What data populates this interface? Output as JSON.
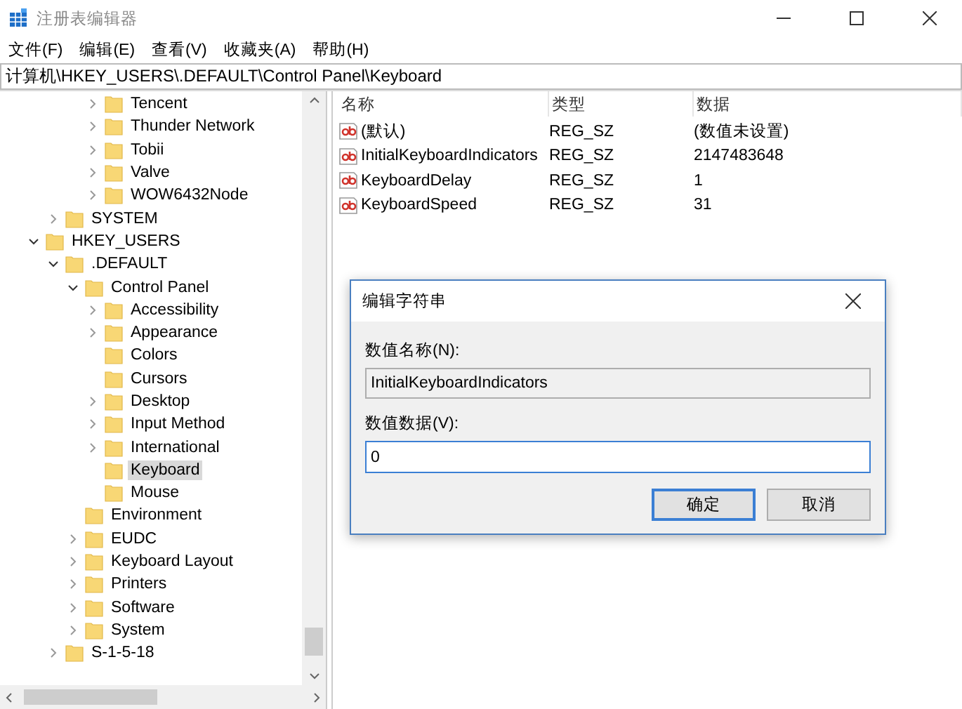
{
  "window": {
    "title": "注册表编辑器"
  },
  "menu": [
    "文件(F)",
    "编辑(E)",
    "查看(V)",
    "收藏夹(A)",
    "帮助(H)"
  ],
  "address": "计算机\\HKEY_USERS\\.DEFAULT\\Control Panel\\Keyboard",
  "tree": [
    {
      "children": [
        {
          "children": [
            {
              "children": [
                {
                  "label": "Tencent",
                  "has_children": true,
                  "expanded": false,
                  "selected": false
                },
                {
                  "label": "Thunder Network",
                  "has_children": true,
                  "expanded": false,
                  "selected": false
                },
                {
                  "label": "Tobii",
                  "has_children": true,
                  "expanded": false,
                  "selected": false
                },
                {
                  "label": "Valve",
                  "has_children": true,
                  "expanded": false,
                  "selected": false
                },
                {
                  "label": "WOW6432Node",
                  "has_children": true,
                  "expanded": false,
                  "selected": false
                }
              ]
            }
          ]
        },
        {
          "label": "SYSTEM",
          "has_children": true,
          "expanded": false,
          "selected": false
        }
      ]
    },
    {
      "label": "HKEY_USERS",
      "has_children": true,
      "expanded": true,
      "selected": false,
      "children": [
        {
          "label": ".DEFAULT",
          "has_children": true,
          "expanded": true,
          "selected": false,
          "children": [
            {
              "label": "Control Panel",
              "has_children": true,
              "expanded": true,
              "selected": false,
              "children": [
                {
                  "label": "Accessibility",
                  "has_children": true,
                  "expanded": false,
                  "selected": false
                },
                {
                  "label": "Appearance",
                  "has_children": true,
                  "expanded": false,
                  "selected": false
                },
                {
                  "label": "Colors",
                  "has_children": false,
                  "selected": false
                },
                {
                  "label": "Cursors",
                  "has_children": false,
                  "selected": false
                },
                {
                  "label": "Desktop",
                  "has_children": true,
                  "expanded": false,
                  "selected": false
                },
                {
                  "label": "Input Method",
                  "has_children": true,
                  "expanded": false,
                  "selected": false
                },
                {
                  "label": "International",
                  "has_children": true,
                  "expanded": false,
                  "selected": false
                },
                {
                  "label": "Keyboard",
                  "has_children": false,
                  "selected": true
                },
                {
                  "label": "Mouse",
                  "has_children": false,
                  "selected": false
                }
              ]
            },
            {
              "label": "Environment",
              "has_children": false,
              "selected": false
            },
            {
              "label": "EUDC",
              "has_children": true,
              "expanded": false,
              "selected": false
            },
            {
              "label": "Keyboard Layout",
              "has_children": true,
              "expanded": false,
              "selected": false
            },
            {
              "label": "Printers",
              "has_children": true,
              "expanded": false,
              "selected": false
            },
            {
              "label": "Software",
              "has_children": true,
              "expanded": false,
              "selected": false
            },
            {
              "label": "System",
              "has_children": true,
              "expanded": false,
              "selected": false
            }
          ]
        },
        {
          "label": "S-1-5-18",
          "has_children": true,
          "expanded": false,
          "selected": false
        }
      ]
    }
  ],
  "table": {
    "columns": [
      "名称",
      "类型",
      "数据"
    ],
    "rows": [
      [
        "(默认)",
        "REG_SZ",
        "(数值未设置)"
      ],
      [
        "InitialKeyboardIndicators",
        "REG_SZ",
        "2147483648"
      ],
      [
        "KeyboardDelay",
        "REG_SZ",
        "1"
      ],
      [
        "KeyboardSpeed",
        "REG_SZ",
        "31"
      ]
    ]
  },
  "dialog": {
    "title": "编辑字符串",
    "name_label": "数值名称(N):",
    "name_value": "InitialKeyboardIndicators",
    "data_label": "数值数据(V):",
    "data_value": "0",
    "buttons": [
      {
        "label": "确定",
        "focused": true
      },
      {
        "label": "取消",
        "focused": false
      }
    ]
  }
}
